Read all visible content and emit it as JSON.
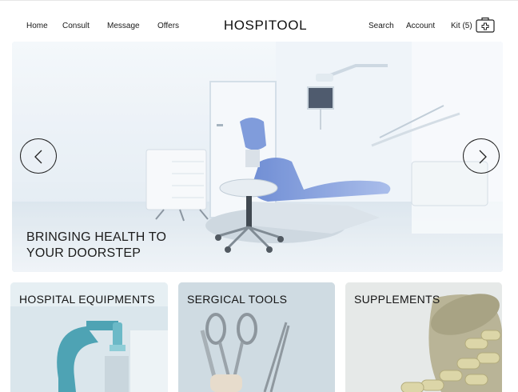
{
  "header": {
    "nav": [
      {
        "label": "Home"
      },
      {
        "label": "Consult"
      },
      {
        "label": "Message"
      },
      {
        "label": "Offers"
      }
    ],
    "brand": "HOSPITOOL",
    "right": {
      "search": "Search",
      "account": "Account",
      "kit": "Kit (5)"
    },
    "kit_icon": "medical-kit-icon"
  },
  "hero": {
    "caption": "BRINGING HEALTH TO\nYOUR DOORSTEP",
    "prev_icon": "chevron-left-icon",
    "next_icon": "chevron-right-icon"
  },
  "categories": [
    {
      "title": "HOSPITAL EQUIPMENTS"
    },
    {
      "title": "SERGICAL TOOLS"
    },
    {
      "title": "SUPPLEMENTS"
    }
  ],
  "colors": {
    "text": "#1a1a1a",
    "hero_tint": "#e3edf5",
    "chair_blue": "#6f8fd6"
  }
}
